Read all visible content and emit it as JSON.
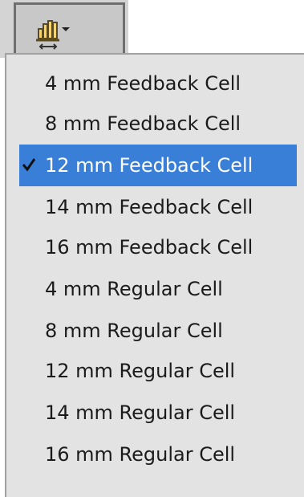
{
  "toolbar": {
    "button_icon": "cell-tool-dropdown-icon"
  },
  "menu": {
    "selected_index": 2,
    "items": [
      {
        "label": "4 mm Feedback Cell",
        "checked": false
      },
      {
        "label": "8 mm Feedback Cell",
        "checked": false
      },
      {
        "label": "12 mm Feedback Cell",
        "checked": true
      },
      {
        "label": "14 mm Feedback Cell",
        "checked": false
      },
      {
        "label": "16 mm Feedback Cell",
        "checked": false
      },
      {
        "label": "4 mm Regular Cell",
        "checked": false
      },
      {
        "label": "8 mm Regular Cell",
        "checked": false
      },
      {
        "label": "12 mm Regular Cell",
        "checked": false
      },
      {
        "label": "14 mm Regular Cell",
        "checked": false
      },
      {
        "label": "16 mm Regular Cell",
        "checked": false
      }
    ]
  },
  "colors": {
    "highlight": "#3a7fd7",
    "menu_background": "#e3e3e3",
    "toolbar_background": "#d4d4d4",
    "icon_fill": "#ffd35c",
    "icon_outline": "#5a4a1e"
  }
}
